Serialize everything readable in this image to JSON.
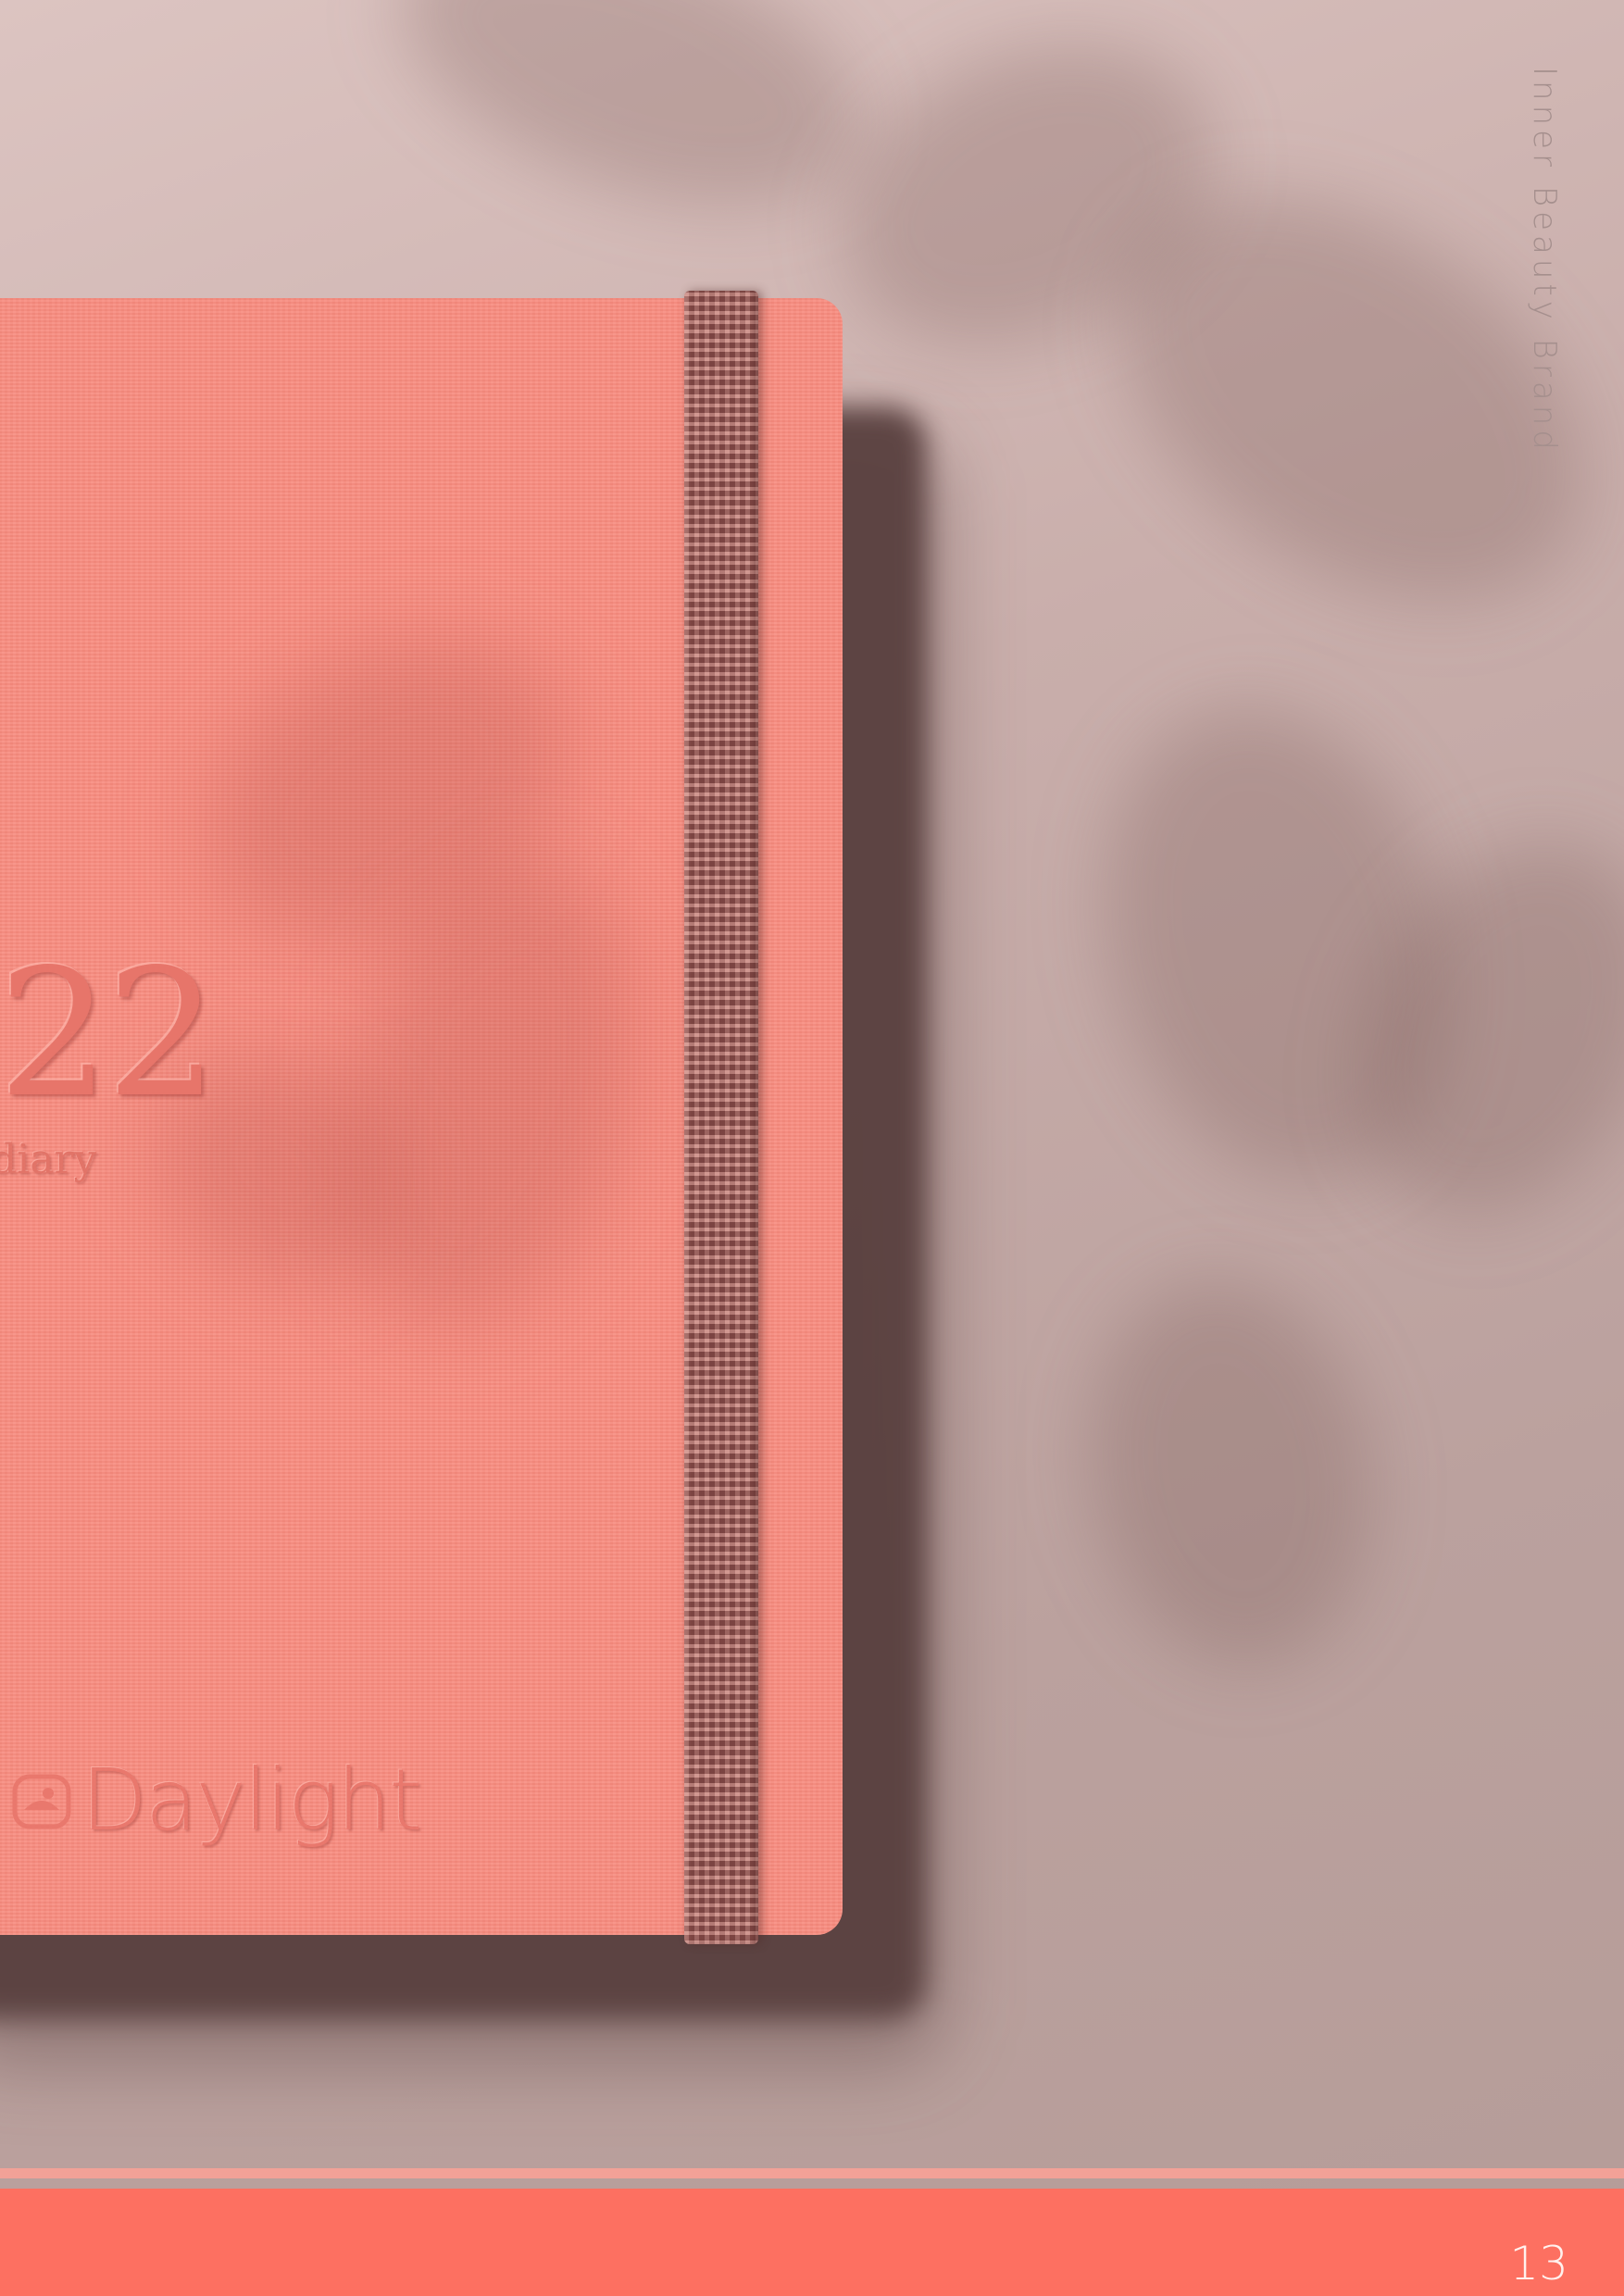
{
  "tagline": "Inner Beauty Brand",
  "notebook": {
    "year": "22",
    "subtitle": "diary",
    "brand": "Daylight",
    "cover_color": "#f88d80",
    "band_color": "#a0625f"
  },
  "footer": {
    "page_number": "13",
    "accent_color": "#fd7061"
  }
}
